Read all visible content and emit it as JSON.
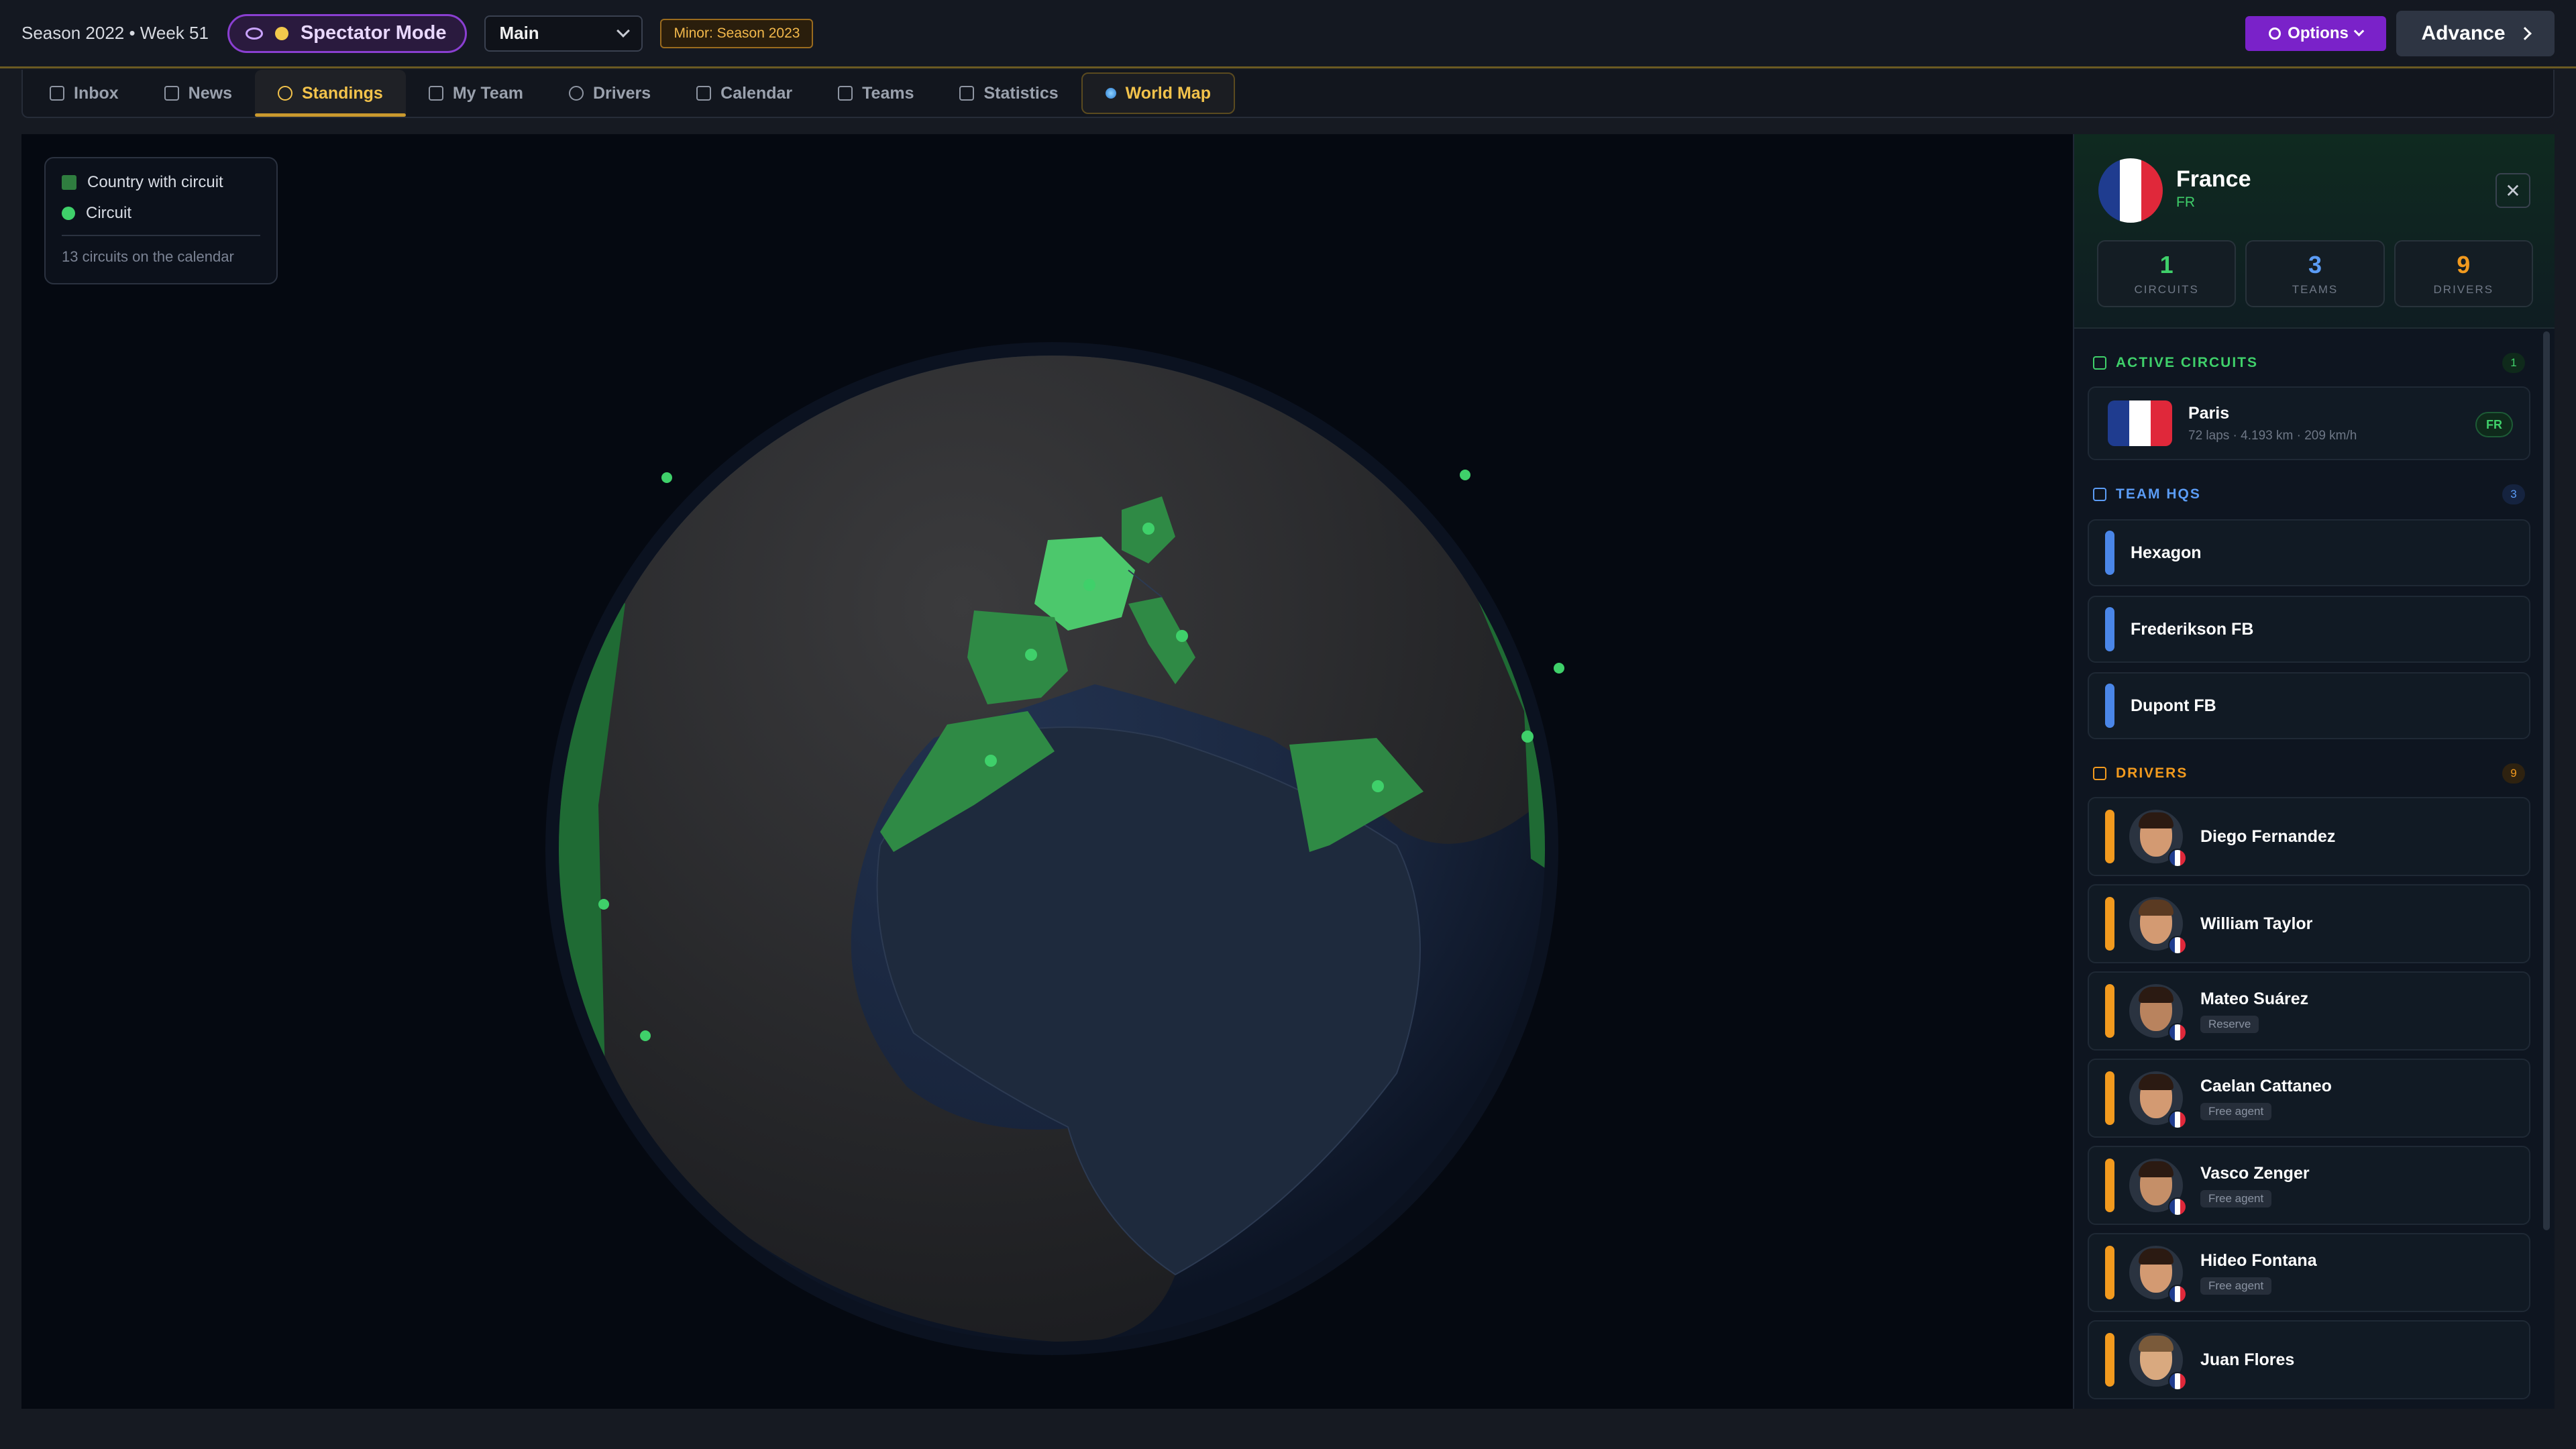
{
  "topbar": {
    "season": "Season 2022 • Week 51",
    "spectator_label": "Spectator Mode",
    "save_select": "Main",
    "minor_badge": "Minor: Season 2023",
    "options_label": "Options",
    "advance_label": "Advance"
  },
  "tabs": [
    {
      "label": "Inbox",
      "icon": "inbox-icon"
    },
    {
      "label": "News",
      "icon": "news-icon"
    },
    {
      "label": "Standings",
      "icon": "trophy-icon"
    },
    {
      "label": "My Team",
      "icon": "user-icon"
    },
    {
      "label": "Drivers",
      "icon": "eye-icon"
    },
    {
      "label": "Calendar",
      "icon": "calendar-icon"
    },
    {
      "label": "Teams",
      "icon": "wrench-icon"
    },
    {
      "label": "Statistics",
      "icon": "chart-icon"
    },
    {
      "label": "World Map",
      "icon": "globe-icon"
    }
  ],
  "legend": {
    "country_label": "Country with circuit",
    "circuit_label": "Circuit",
    "summary": "13 circuits on the calendar"
  },
  "country": {
    "name": "France",
    "code": "FR",
    "stats": [
      {
        "value": "1",
        "label": "CIRCUITS",
        "color": "#3fd06a"
      },
      {
        "value": "3",
        "label": "TEAMS",
        "color": "#5b9cf5"
      },
      {
        "value": "9",
        "label": "DRIVERS",
        "color": "#f29a1e"
      }
    ],
    "active_circuits_title": "ACTIVE CIRCUITS",
    "active_circuits_count": "1",
    "circuits": [
      {
        "name": "Paris",
        "details": "72 laps · 4.193 km · 209 km/h",
        "badge": "FR"
      }
    ],
    "team_hqs_title": "TEAM HQS",
    "team_hqs_count": "3",
    "teams": [
      "Hexagon",
      "Frederikson FB",
      "Dupont FB"
    ],
    "drivers_title": "DRIVERS",
    "drivers_count": "9",
    "drivers": [
      {
        "name": "Diego Fernandez",
        "tag": ""
      },
      {
        "name": "William Taylor",
        "tag": ""
      },
      {
        "name": "Mateo Suárez",
        "tag": "Reserve"
      },
      {
        "name": "Caelan Cattaneo",
        "tag": "Free agent"
      },
      {
        "name": "Vasco Zenger",
        "tag": "Free agent"
      },
      {
        "name": "Hideo Fontana",
        "tag": "Free agent"
      },
      {
        "name": "Juan Flores",
        "tag": ""
      }
    ]
  },
  "colors": {
    "accent_gold": "#f2c24b",
    "spectator_purple": "#8a3fd1",
    "circuit_green": "#3fd06a",
    "team_blue": "#5b9cf5",
    "driver_orange": "#f29a1e"
  }
}
